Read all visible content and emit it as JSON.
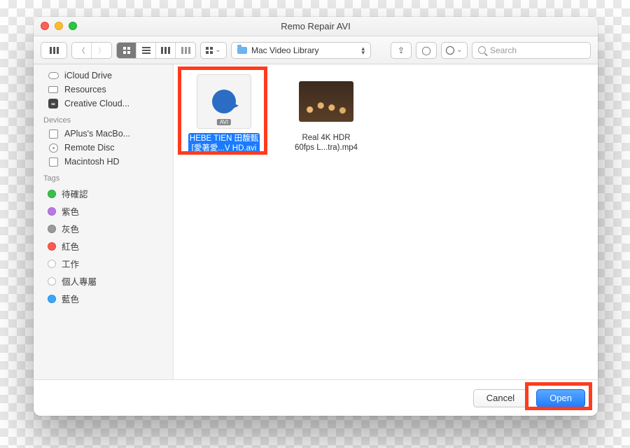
{
  "window": {
    "title": "Remo Repair AVI"
  },
  "toolbar": {
    "path_label": "Mac Video Library",
    "search_placeholder": "Search"
  },
  "sidebar": {
    "favorites": [
      {
        "label": "iCloud Drive",
        "icon": "cloud"
      },
      {
        "label": "Resources",
        "icon": "folder"
      },
      {
        "label": "Creative Cloud...",
        "icon": "cc"
      }
    ],
    "devices_header": "Devices",
    "devices": [
      {
        "label": "APlus's MacBo...",
        "icon": "laptop"
      },
      {
        "label": "Remote Disc",
        "icon": "cd"
      },
      {
        "label": "Macintosh HD",
        "icon": "disk"
      }
    ],
    "tags_header": "Tags",
    "tags": [
      {
        "label": "待確認",
        "color": "#39c24a"
      },
      {
        "label": "紫色",
        "color": "#b978e8"
      },
      {
        "label": "灰色",
        "color": "#9a9a9a"
      },
      {
        "label": "紅色",
        "color": "#ff5a4d"
      },
      {
        "label": "工作",
        "color": "#ffffff"
      },
      {
        "label": "個人專屬",
        "color": "#ffffff"
      },
      {
        "label": "藍色",
        "color": "#38a7ff"
      }
    ]
  },
  "files": [
    {
      "name_line1": "HEBE TIEN 田馥甄",
      "name_line2": "[愛著愛...V HD.avi",
      "type": "avi",
      "selected": true
    },
    {
      "name_line1": "Real 4K HDR",
      "name_line2": "60fps  L...tra).mp4",
      "type": "mp4",
      "selected": false
    }
  ],
  "footer": {
    "cancel": "Cancel",
    "open": "Open"
  }
}
